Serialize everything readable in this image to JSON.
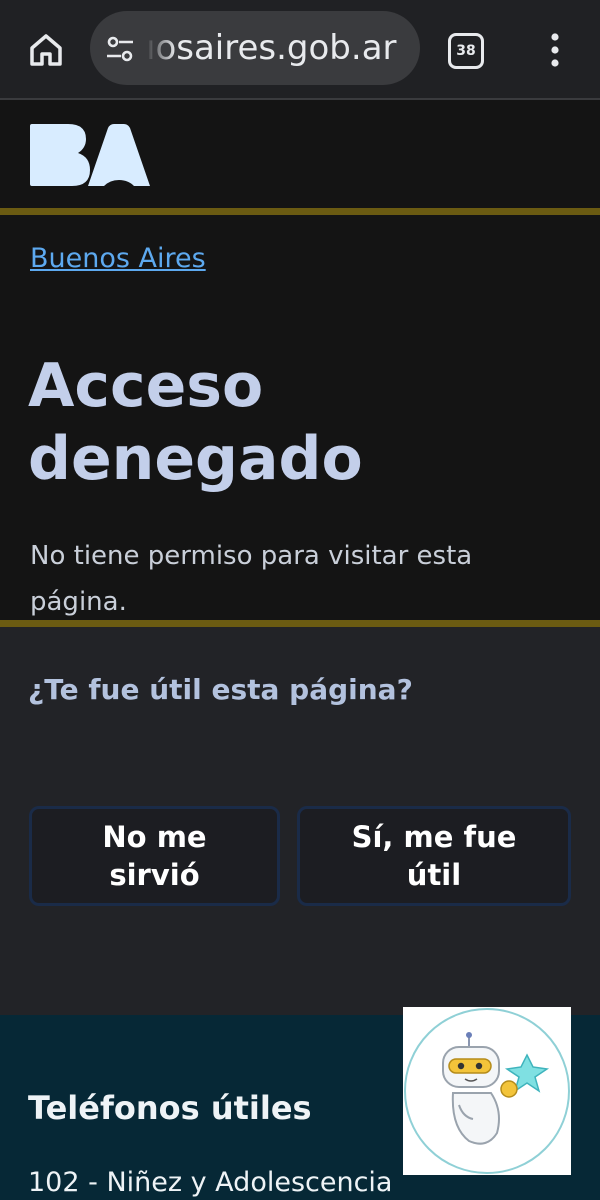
{
  "browser": {
    "url_text": "ıosaires.gob.ar",
    "tab_count": "38",
    "icons": [
      "home-icon",
      "site-settings-icon",
      "tab-switcher-icon",
      "more-options-icon"
    ]
  },
  "header": {
    "logo_alt": "BA",
    "accent_color": "#6b5b12"
  },
  "content": {
    "breadcrumb": "Buenos Aires",
    "title": "Acceso denegado",
    "description": "No tiene permiso para visitar esta página."
  },
  "feedback": {
    "question": "¿Te fue útil esta página?",
    "no_label": "No me sirvió",
    "yes_label": "Sí, me fue útil"
  },
  "footer": {
    "heading": "Teléfonos útiles",
    "items": [
      "102 - Niñez y Adolescencia"
    ]
  },
  "chatbot": {
    "icon": "chatbot-robot-icon"
  },
  "colors": {
    "link": "#5da9ef",
    "title": "#c3cfea",
    "footer_bg": "#062836",
    "feedback_bg": "#222327"
  }
}
